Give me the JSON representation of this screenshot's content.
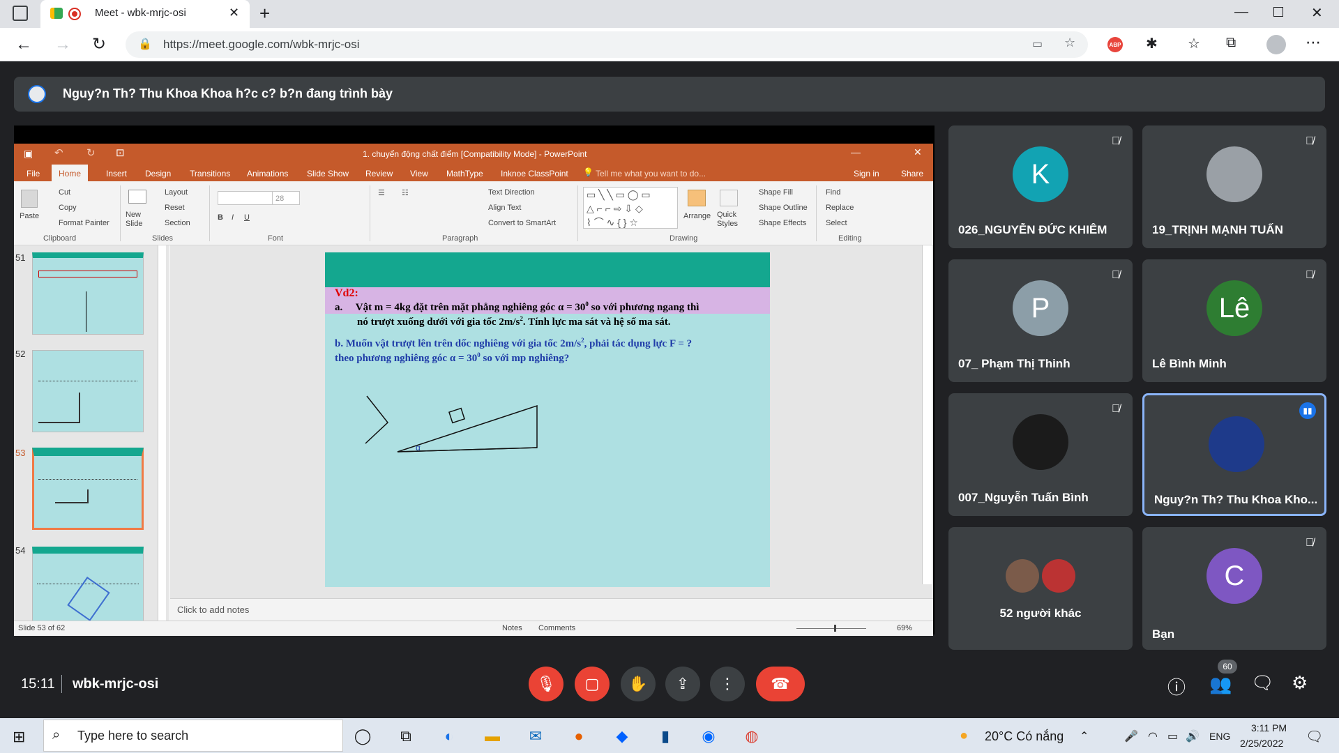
{
  "browser": {
    "tab_title": "Meet - wbk-mrjc-osi",
    "url": "https://meet.google.com/wbk-mrjc-osi",
    "abp_label": "ABP"
  },
  "presenter_bar": {
    "text": "Nguy?n Th? Thu Khoa Khoa h?c c? b?n đang trình bày"
  },
  "powerpoint": {
    "title": "1. chuyển động chất điểm [Compatibility Mode] - PowerPoint",
    "tabs": [
      "File",
      "Home",
      "Insert",
      "Design",
      "Transitions",
      "Animations",
      "Slide Show",
      "Review",
      "View",
      "MathType",
      "Inknoe ClassPoint"
    ],
    "tell_me": "Tell me what you want to do...",
    "sign_in": "Sign in",
    "share": "Share",
    "clipboard": {
      "paste": "Paste",
      "cut": "Cut",
      "copy": "Copy",
      "format_painter": "Format Painter",
      "group": "Clipboard"
    },
    "slides": {
      "new_slide": "New Slide",
      "layout": "Layout",
      "reset": "Reset",
      "section": "Section",
      "group": "Slides"
    },
    "font": {
      "size": "28",
      "group": "Font"
    },
    "paragraph": {
      "text_direction": "Text Direction",
      "align_text": "Align Text",
      "smartart": "Convert to SmartArt",
      "group": "Paragraph"
    },
    "drawing": {
      "arrange": "Arrange",
      "quick_styles": "Quick Styles",
      "shape_fill": "Shape Fill",
      "shape_outline": "Shape Outline",
      "shape_effects": "Shape Effects",
      "group": "Drawing"
    },
    "editing": {
      "find": "Find",
      "replace": "Replace",
      "select": "Select",
      "group": "Editing"
    },
    "thumb_numbers": [
      "51",
      "52",
      "53",
      "54"
    ],
    "slide": {
      "heading": "Vd2:",
      "line_a_prefix": "a.",
      "line_a1": "Vật m = 4kg đặt trên mặt phẳng nghiêng góc α = 30",
      "line_a1_sup": "0",
      "line_a1_end": " so với phương ngang thì",
      "line_a2": "nó trượt xuống dưới với gia tốc 2m/s",
      "line_a2_sup": "2",
      "line_a2_end": ". Tính lực ma sát và hệ số ma sát.",
      "line_b1": "b. Muốn vật trượt lên trên dốc nghiêng với gia tốc 2m/s",
      "line_b1_sup": "2",
      "line_b1_end": ", phải tác dụng lực F = ?",
      "line_b2": "theo phương nghiêng góc α = 30",
      "line_b2_sup": "0",
      "line_b2_end": " so với mp nghiêng?",
      "alpha_label": "α"
    },
    "notes_placeholder": "Click to add notes",
    "status": {
      "slide_counter": "Slide 53 of 62",
      "notes": "Notes",
      "comments": "Comments",
      "zoom": "69%"
    }
  },
  "participants": [
    {
      "name": "026_NGUYỄN ĐỨC KHIÊM",
      "initial": "K",
      "color": "#12a3b3",
      "muted": true
    },
    {
      "name": "19_TRỊNH MẠNH TUẤN",
      "initial": "",
      "color": "#9aa0a6",
      "muted": true
    },
    {
      "name": "07_ Phạm Thị Thinh",
      "initial": "P",
      "color": "#8c9ea8",
      "muted": true
    },
    {
      "name": "Lê Bình Minh",
      "initial": "Lê",
      "color": "#2e7d32",
      "muted": true
    },
    {
      "name": "007_Nguyễn Tuấn Bình",
      "initial": "",
      "color": "#1b1b1b",
      "muted": true
    },
    {
      "name": "Nguy?n Th? Thu Khoa Kho...",
      "initial": "",
      "color": "#1e3a8a",
      "muted": false,
      "speaking": true
    },
    {
      "name": "52 người khác",
      "initial": "",
      "color": "#5f6368",
      "muted": false
    },
    {
      "name": "Bạn",
      "initial": "C",
      "color": "#7e57c2",
      "muted": true
    }
  ],
  "meeting": {
    "time": "15:11",
    "code": "wbk-mrjc-osi",
    "people_count": "60"
  },
  "taskbar": {
    "search_placeholder": "Type here to search",
    "weather": "20°C Có nắng",
    "lang": "ENG",
    "time": "3:11 PM",
    "date": "2/25/2022"
  }
}
